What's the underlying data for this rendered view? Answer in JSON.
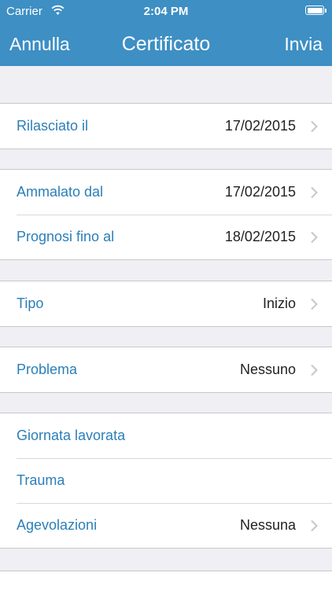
{
  "status_bar": {
    "carrier": "Carrier",
    "time": "2:04 PM"
  },
  "nav": {
    "left": "Annulla",
    "title": "Certificato",
    "right": "Invia"
  },
  "sections": [
    {
      "rows": [
        {
          "label": "Rilasciato il",
          "value": "17/02/2015",
          "chevron": true
        }
      ]
    },
    {
      "rows": [
        {
          "label": "Ammalato dal",
          "value": "17/02/2015",
          "chevron": true
        },
        {
          "label": "Prognosi fino al",
          "value": "18/02/2015",
          "chevron": true
        }
      ]
    },
    {
      "rows": [
        {
          "label": "Tipo",
          "value": "Inizio",
          "chevron": true
        }
      ]
    },
    {
      "rows": [
        {
          "label": "Problema",
          "value": "Nessuno",
          "chevron": true
        }
      ]
    },
    {
      "rows": [
        {
          "label": "Giornata lavorata",
          "value": "",
          "chevron": false
        },
        {
          "label": "Trauma",
          "value": "",
          "chevron": false
        },
        {
          "label": "Agevolazioni",
          "value": "Nessuna",
          "chevron": true
        }
      ]
    }
  ],
  "colors": {
    "nav_bar": "#3d8fc4",
    "label": "#2b7fb8",
    "background": "#efeff4"
  },
  "icons": {
    "wifi": "wifi-icon",
    "battery": "battery-icon",
    "chevron": "chevron-right-icon"
  }
}
